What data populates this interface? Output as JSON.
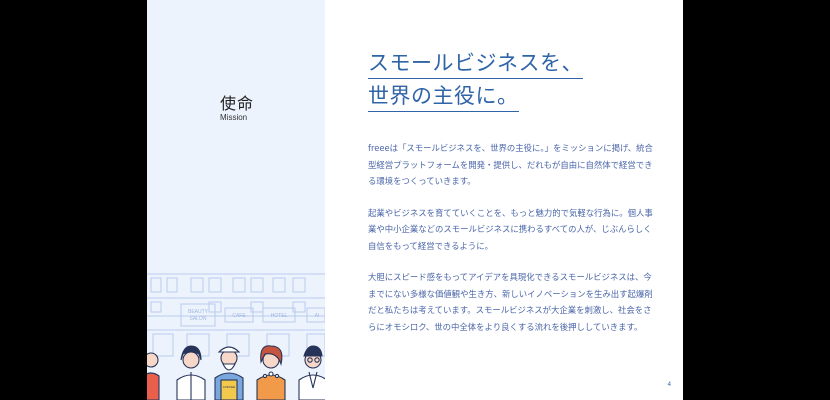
{
  "section": {
    "title": "使命",
    "subtitle": "Mission"
  },
  "headline": {
    "line1": "スモールビジネスを、",
    "line2": "世界の主役に。"
  },
  "paragraphs": [
    "freeeは「スモールビジネスを、世界の主役に。」をミッションに掲げ、統合型経営プラットフォームを開発・提供し、だれもが自由に自然体で経営できる環境をつくっていきます。",
    "起業やビジネスを育てていくことを、もっと魅力的で気軽な行為に。個人事業や中小企業などのスモールビジネスに携わるすべての人が、じぶんらしく自信をもって経営できるように。",
    "大胆にスピード感をもってアイデアを具現化できるスモールビジネスは、今までにない多様な価値観や生き方、新しいイノベーションを生み出す起爆剤だと私たちは考えています。スモールビジネスが大企業を刺激し、社会をさらにオモシロク、世の中全体をより良くする流れを後押ししていきます。"
  ],
  "illustration": {
    "signs": [
      "BEAUTY",
      "SALON",
      "CAFE",
      "HOTEL",
      "AI"
    ],
    "apron_text": "COFFEE"
  },
  "page_number": "4",
  "colors": {
    "accent": "#2f64a7",
    "body_text": "#4a66a8",
    "panel_bg": "#edf3fd",
    "letterbox": "#000000"
  }
}
